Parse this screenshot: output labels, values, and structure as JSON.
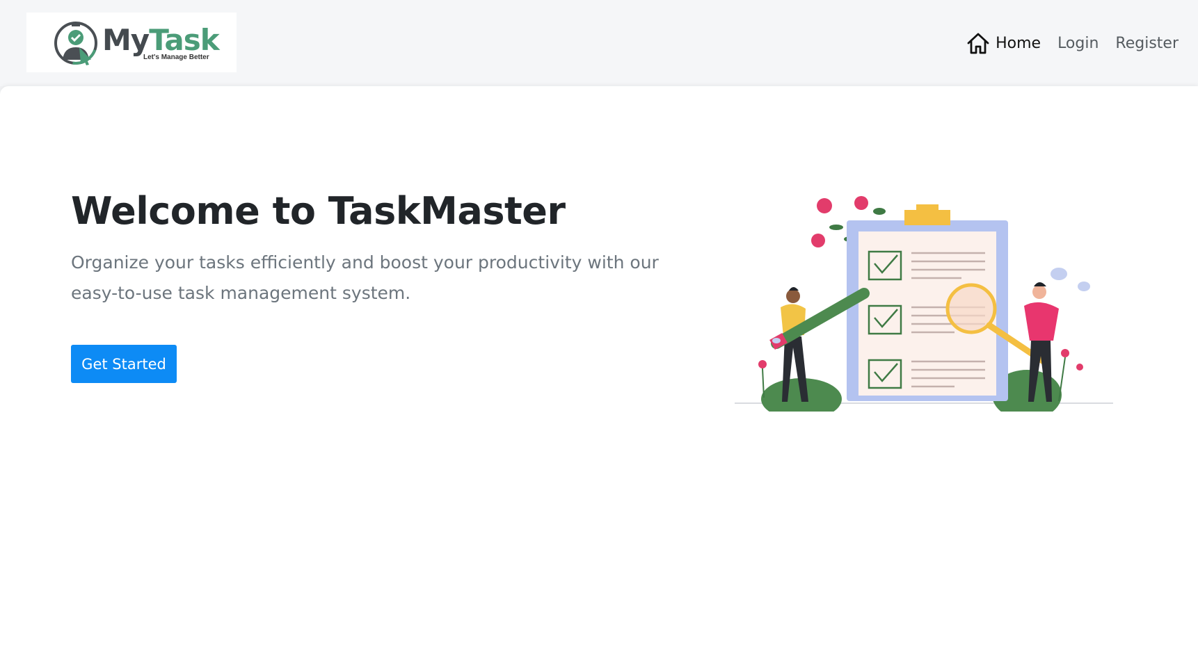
{
  "brand": {
    "name_part1": "My",
    "name_part2": "Task",
    "tagline": "Let's Manage Better"
  },
  "nav": {
    "home": "Home",
    "login": "Login",
    "register": "Register"
  },
  "hero": {
    "title": "Welcome to TaskMaster",
    "subtitle": "Organize your tasks efficiently and boost your productivity with our easy-to-use task management system.",
    "button": "Get Started"
  },
  "colors": {
    "primary_button": "#0d8bf5",
    "brand_green": "#4b9c78",
    "text_dark": "#212529",
    "text_muted": "#6c757d"
  },
  "icons": {
    "home": "home-icon",
    "logo": "clock-check-logo-icon"
  }
}
